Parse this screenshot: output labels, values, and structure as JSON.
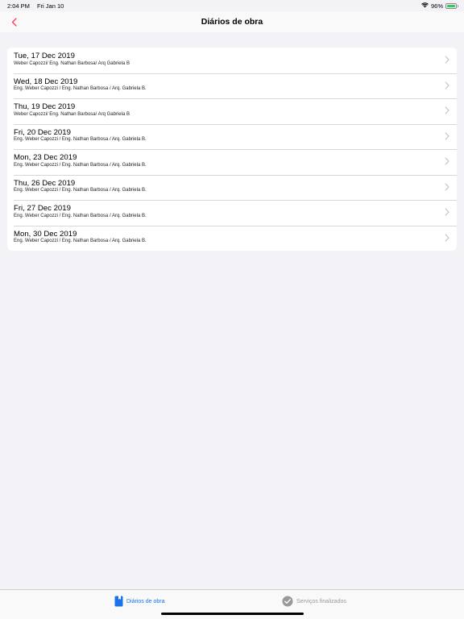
{
  "status": {
    "time": "2:04 PM",
    "date": "Fri Jan 10",
    "battery_text": "96%",
    "battery_level": 0.96
  },
  "nav": {
    "title": "Diários de obra",
    "accent": "#ff375f"
  },
  "entries": [
    {
      "date": "Tue, 17 Dec 2019",
      "team": "Weber Capozzi/ Eng. Nathan Barbosa/ Arq Gabriela B"
    },
    {
      "date": "Wed, 18 Dec 2019",
      "team": "Eng. Weber Capozzi / Eng. Nathan Barbosa / Arq. Gabriela B."
    },
    {
      "date": "Thu, 19 Dec 2019",
      "team": "Weber Capozzi/ Eng. Nathan Barbosa/ Arq Gabriela B"
    },
    {
      "date": "Fri, 20 Dec 2019",
      "team": "Eng. Weber Capozzi / Eng. Nathan Barbosa / Arq. Gabriela B."
    },
    {
      "date": "Mon, 23 Dec 2019",
      "team": "Eng. Weber Capozzi / Eng. Nathan Barbosa / Arq. Gabriela B."
    },
    {
      "date": "Thu, 26 Dec 2019",
      "team": "Eng. Weber Capozzi / Eng. Nathan Barbosa / Arq. Gabriela B."
    },
    {
      "date": "Fri, 27 Dec 2019",
      "team": "Eng. Weber Capozzi / Eng. Nathan Barbosa / Arq. Gabriela B."
    },
    {
      "date": "Mon, 30 Dec 2019",
      "team": "Eng. Weber Capozzi / Eng. Nathan Barbosa / Arq. Gabriela B."
    }
  ],
  "tabs": [
    {
      "label": "Diários de obra",
      "icon": "book-icon",
      "selected": true,
      "color": "#1a73e8"
    },
    {
      "label": "Serviços finalizados",
      "icon": "checkmark-circle-icon",
      "selected": false,
      "color": "#999999"
    }
  ]
}
